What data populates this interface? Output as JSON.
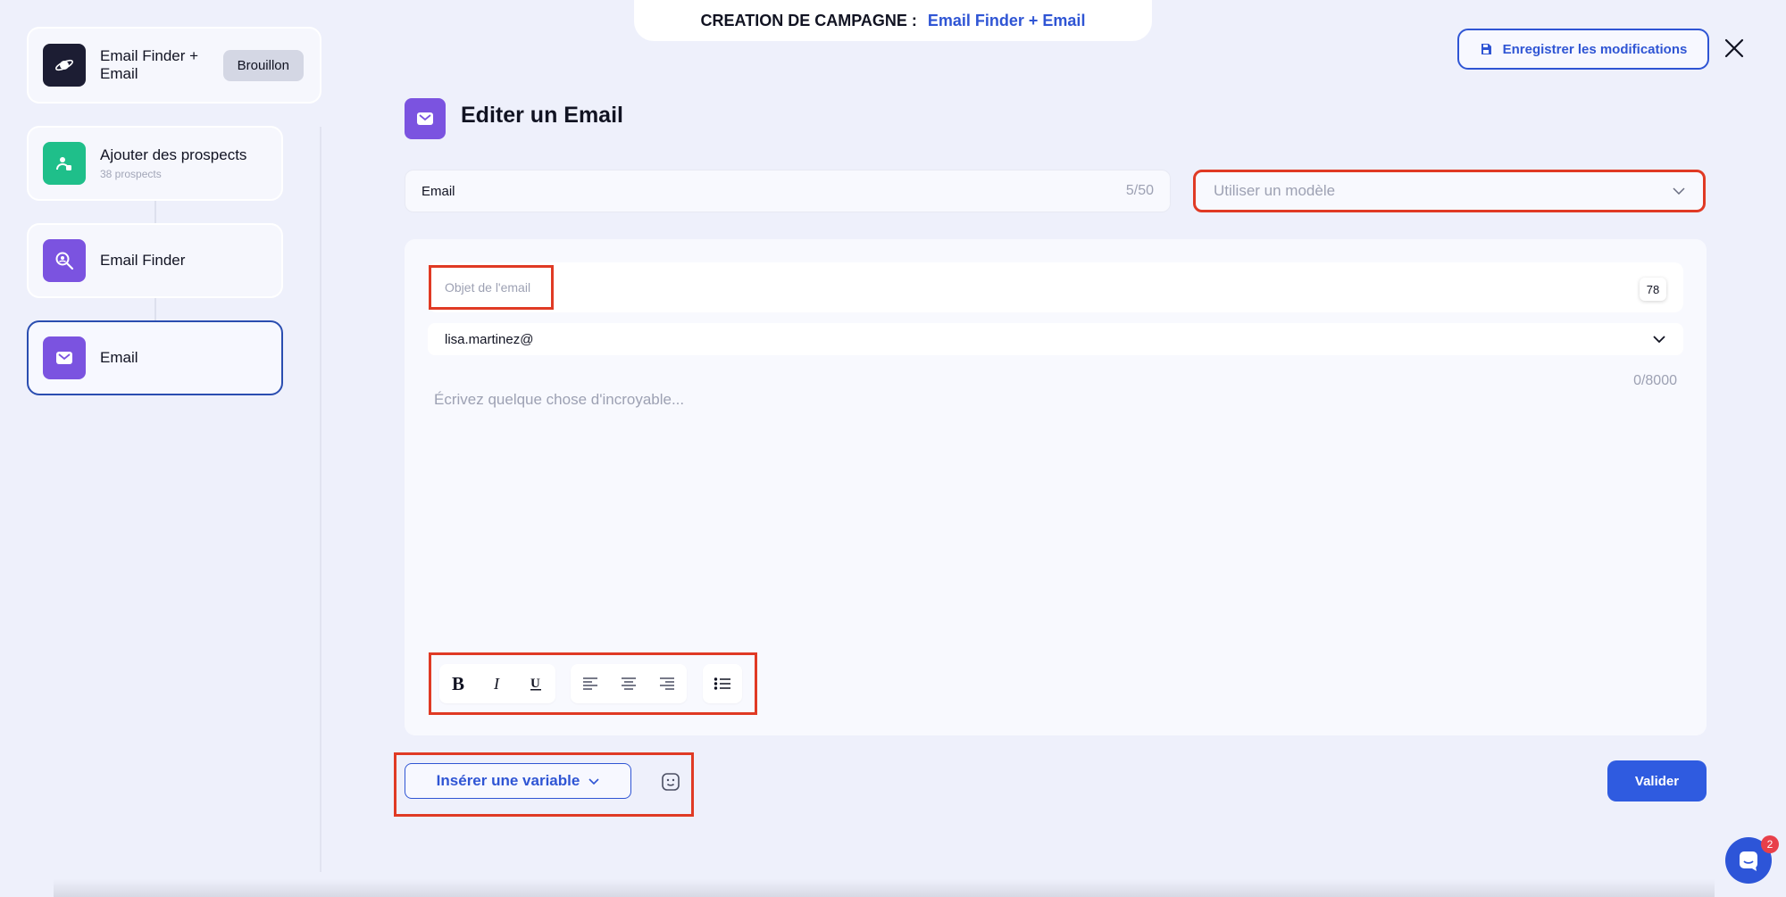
{
  "banner": {
    "label": "CREATION DE CAMPAGNE :",
    "campaign_name": "Email Finder + Email"
  },
  "header": {
    "save_label": "Enregistrer les modifications"
  },
  "sidebar": {
    "campaign": {
      "title": "Email Finder + Email",
      "badge": "Brouillon"
    },
    "steps": [
      {
        "title": "Ajouter des prospects",
        "subtitle": "38 prospects",
        "icon": "user-add-icon",
        "color": "#1fbf8a"
      },
      {
        "title": "Email Finder",
        "icon": "search-user-icon",
        "color": "#7b53e0"
      },
      {
        "title": "Email",
        "icon": "mail-icon",
        "color": "#7b53e0",
        "active": true
      }
    ]
  },
  "editor": {
    "title": "Editer un Email",
    "name_value": "Email",
    "name_count": "5/50",
    "template_placeholder": "Utiliser un modèle",
    "subject_placeholder": "Objet de l'email",
    "subject_count": "78",
    "sender": "lisa.martinez@",
    "body_count": "0/8000",
    "body_placeholder": "Écrivez quelque chose d'incroyable...",
    "toolbar": [
      "bold-icon",
      "italic-icon",
      "underline-icon",
      "align-left-icon",
      "align-center-icon",
      "align-right-icon",
      "bullet-list-icon"
    ],
    "insert_variable_label": "Insérer une variable",
    "validate_label": "Valider"
  },
  "chat": {
    "unread": "2"
  },
  "colors": {
    "accent": "#2f55d4",
    "highlight": "#e03a24",
    "purple": "#7b53e0",
    "green": "#1fbf8a"
  }
}
